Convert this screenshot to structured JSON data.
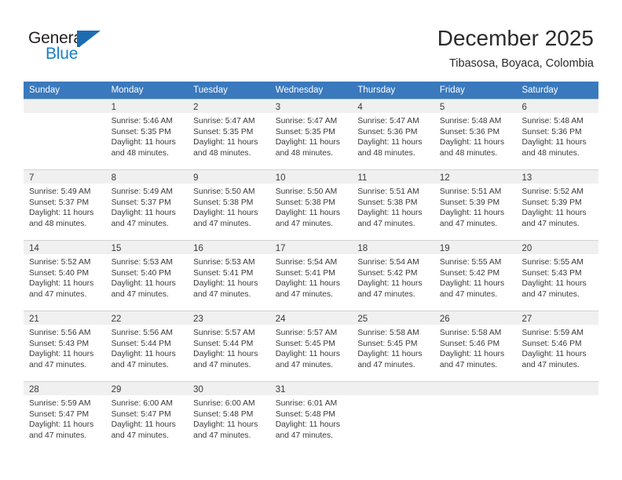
{
  "brand": {
    "name_top": "General",
    "name_bottom": "Blue",
    "mark": "blue-triangle-logo-icon",
    "color_dark": "#231f20",
    "color_blue": "#1c7fc4"
  },
  "header": {
    "title": "December 2025",
    "subtitle": "Tibasosa, Boyaca, Colombia"
  },
  "theme": {
    "header_blue": "#3a79bd",
    "day_band_gray": "#f0f0f0",
    "grid_line": "#d3d3d3",
    "text": "#3a3a3a"
  },
  "calendar": {
    "weekdays": [
      "Sunday",
      "Monday",
      "Tuesday",
      "Wednesday",
      "Thursday",
      "Friday",
      "Saturday"
    ],
    "weeks": [
      [
        {
          "day": "",
          "sunrise": "",
          "sunset": "",
          "daylight_line1": "",
          "daylight_line2": ""
        },
        {
          "day": "1",
          "sunrise": "Sunrise: 5:46 AM",
          "sunset": "Sunset: 5:35 PM",
          "daylight_line1": "Daylight: 11 hours",
          "daylight_line2": "and 48 minutes."
        },
        {
          "day": "2",
          "sunrise": "Sunrise: 5:47 AM",
          "sunset": "Sunset: 5:35 PM",
          "daylight_line1": "Daylight: 11 hours",
          "daylight_line2": "and 48 minutes."
        },
        {
          "day": "3",
          "sunrise": "Sunrise: 5:47 AM",
          "sunset": "Sunset: 5:35 PM",
          "daylight_line1": "Daylight: 11 hours",
          "daylight_line2": "and 48 minutes."
        },
        {
          "day": "4",
          "sunrise": "Sunrise: 5:47 AM",
          "sunset": "Sunset: 5:36 PM",
          "daylight_line1": "Daylight: 11 hours",
          "daylight_line2": "and 48 minutes."
        },
        {
          "day": "5",
          "sunrise": "Sunrise: 5:48 AM",
          "sunset": "Sunset: 5:36 PM",
          "daylight_line1": "Daylight: 11 hours",
          "daylight_line2": "and 48 minutes."
        },
        {
          "day": "6",
          "sunrise": "Sunrise: 5:48 AM",
          "sunset": "Sunset: 5:36 PM",
          "daylight_line1": "Daylight: 11 hours",
          "daylight_line2": "and 48 minutes."
        }
      ],
      [
        {
          "day": "7",
          "sunrise": "Sunrise: 5:49 AM",
          "sunset": "Sunset: 5:37 PM",
          "daylight_line1": "Daylight: 11 hours",
          "daylight_line2": "and 48 minutes."
        },
        {
          "day": "8",
          "sunrise": "Sunrise: 5:49 AM",
          "sunset": "Sunset: 5:37 PM",
          "daylight_line1": "Daylight: 11 hours",
          "daylight_line2": "and 47 minutes."
        },
        {
          "day": "9",
          "sunrise": "Sunrise: 5:50 AM",
          "sunset": "Sunset: 5:38 PM",
          "daylight_line1": "Daylight: 11 hours",
          "daylight_line2": "and 47 minutes."
        },
        {
          "day": "10",
          "sunrise": "Sunrise: 5:50 AM",
          "sunset": "Sunset: 5:38 PM",
          "daylight_line1": "Daylight: 11 hours",
          "daylight_line2": "and 47 minutes."
        },
        {
          "day": "11",
          "sunrise": "Sunrise: 5:51 AM",
          "sunset": "Sunset: 5:38 PM",
          "daylight_line1": "Daylight: 11 hours",
          "daylight_line2": "and 47 minutes."
        },
        {
          "day": "12",
          "sunrise": "Sunrise: 5:51 AM",
          "sunset": "Sunset: 5:39 PM",
          "daylight_line1": "Daylight: 11 hours",
          "daylight_line2": "and 47 minutes."
        },
        {
          "day": "13",
          "sunrise": "Sunrise: 5:52 AM",
          "sunset": "Sunset: 5:39 PM",
          "daylight_line1": "Daylight: 11 hours",
          "daylight_line2": "and 47 minutes."
        }
      ],
      [
        {
          "day": "14",
          "sunrise": "Sunrise: 5:52 AM",
          "sunset": "Sunset: 5:40 PM",
          "daylight_line1": "Daylight: 11 hours",
          "daylight_line2": "and 47 minutes."
        },
        {
          "day": "15",
          "sunrise": "Sunrise: 5:53 AM",
          "sunset": "Sunset: 5:40 PM",
          "daylight_line1": "Daylight: 11 hours",
          "daylight_line2": "and 47 minutes."
        },
        {
          "day": "16",
          "sunrise": "Sunrise: 5:53 AM",
          "sunset": "Sunset: 5:41 PM",
          "daylight_line1": "Daylight: 11 hours",
          "daylight_line2": "and 47 minutes."
        },
        {
          "day": "17",
          "sunrise": "Sunrise: 5:54 AM",
          "sunset": "Sunset: 5:41 PM",
          "daylight_line1": "Daylight: 11 hours",
          "daylight_line2": "and 47 minutes."
        },
        {
          "day": "18",
          "sunrise": "Sunrise: 5:54 AM",
          "sunset": "Sunset: 5:42 PM",
          "daylight_line1": "Daylight: 11 hours",
          "daylight_line2": "and 47 minutes."
        },
        {
          "day": "19",
          "sunrise": "Sunrise: 5:55 AM",
          "sunset": "Sunset: 5:42 PM",
          "daylight_line1": "Daylight: 11 hours",
          "daylight_line2": "and 47 minutes."
        },
        {
          "day": "20",
          "sunrise": "Sunrise: 5:55 AM",
          "sunset": "Sunset: 5:43 PM",
          "daylight_line1": "Daylight: 11 hours",
          "daylight_line2": "and 47 minutes."
        }
      ],
      [
        {
          "day": "21",
          "sunrise": "Sunrise: 5:56 AM",
          "sunset": "Sunset: 5:43 PM",
          "daylight_line1": "Daylight: 11 hours",
          "daylight_line2": "and 47 minutes."
        },
        {
          "day": "22",
          "sunrise": "Sunrise: 5:56 AM",
          "sunset": "Sunset: 5:44 PM",
          "daylight_line1": "Daylight: 11 hours",
          "daylight_line2": "and 47 minutes."
        },
        {
          "day": "23",
          "sunrise": "Sunrise: 5:57 AM",
          "sunset": "Sunset: 5:44 PM",
          "daylight_line1": "Daylight: 11 hours",
          "daylight_line2": "and 47 minutes."
        },
        {
          "day": "24",
          "sunrise": "Sunrise: 5:57 AM",
          "sunset": "Sunset: 5:45 PM",
          "daylight_line1": "Daylight: 11 hours",
          "daylight_line2": "and 47 minutes."
        },
        {
          "day": "25",
          "sunrise": "Sunrise: 5:58 AM",
          "sunset": "Sunset: 5:45 PM",
          "daylight_line1": "Daylight: 11 hours",
          "daylight_line2": "and 47 minutes."
        },
        {
          "day": "26",
          "sunrise": "Sunrise: 5:58 AM",
          "sunset": "Sunset: 5:46 PM",
          "daylight_line1": "Daylight: 11 hours",
          "daylight_line2": "and 47 minutes."
        },
        {
          "day": "27",
          "sunrise": "Sunrise: 5:59 AM",
          "sunset": "Sunset: 5:46 PM",
          "daylight_line1": "Daylight: 11 hours",
          "daylight_line2": "and 47 minutes."
        }
      ],
      [
        {
          "day": "28",
          "sunrise": "Sunrise: 5:59 AM",
          "sunset": "Sunset: 5:47 PM",
          "daylight_line1": "Daylight: 11 hours",
          "daylight_line2": "and 47 minutes."
        },
        {
          "day": "29",
          "sunrise": "Sunrise: 6:00 AM",
          "sunset": "Sunset: 5:47 PM",
          "daylight_line1": "Daylight: 11 hours",
          "daylight_line2": "and 47 minutes."
        },
        {
          "day": "30",
          "sunrise": "Sunrise: 6:00 AM",
          "sunset": "Sunset: 5:48 PM",
          "daylight_line1": "Daylight: 11 hours",
          "daylight_line2": "and 47 minutes."
        },
        {
          "day": "31",
          "sunrise": "Sunrise: 6:01 AM",
          "sunset": "Sunset: 5:48 PM",
          "daylight_line1": "Daylight: 11 hours",
          "daylight_line2": "and 47 minutes."
        },
        {
          "day": "",
          "sunrise": "",
          "sunset": "",
          "daylight_line1": "",
          "daylight_line2": ""
        },
        {
          "day": "",
          "sunrise": "",
          "sunset": "",
          "daylight_line1": "",
          "daylight_line2": ""
        },
        {
          "day": "",
          "sunrise": "",
          "sunset": "",
          "daylight_line1": "",
          "daylight_line2": ""
        }
      ]
    ]
  }
}
